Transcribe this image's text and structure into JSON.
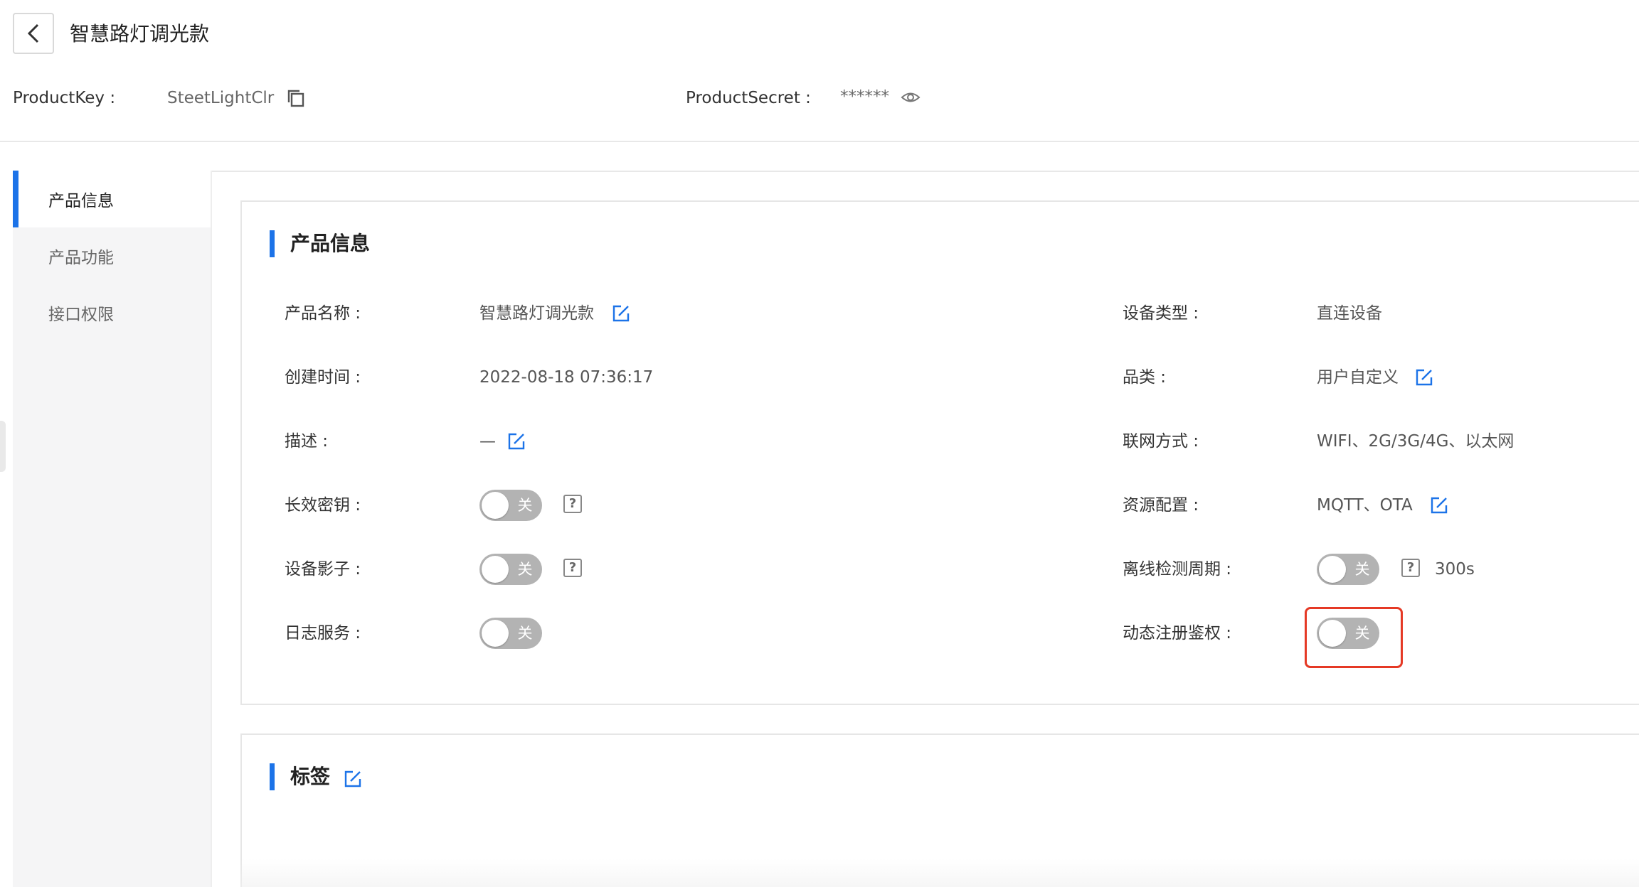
{
  "header": {
    "title": "智慧路灯调光款",
    "product_key_label": "ProductKey :",
    "product_key_value": "SteetLightClr",
    "product_secret_label": "ProductSecret :",
    "product_secret_value": "******"
  },
  "sidebar": {
    "items": [
      {
        "label": "产品信息",
        "active": true
      },
      {
        "label": "产品功能",
        "active": false
      },
      {
        "label": "接口权限",
        "active": false
      }
    ]
  },
  "product_info": {
    "section_title": "产品信息",
    "left_fields": [
      {
        "label": "产品名称 :",
        "value": "智慧路灯调光款"
      },
      {
        "label": "创建时间 :",
        "value": "2022-08-18 07:36:17"
      },
      {
        "label": "描述 :",
        "value": "—"
      },
      {
        "label": "长效密钥 :",
        "toggle_text": "关"
      },
      {
        "label": "设备影子 :",
        "toggle_text": "关"
      },
      {
        "label": "日志服务 :",
        "toggle_text": "关"
      }
    ],
    "right_fields": [
      {
        "label": "设备类型 :",
        "value": "直连设备"
      },
      {
        "label": "品类 :",
        "value": "用户自定义"
      },
      {
        "label": "联网方式 :",
        "value": "WIFI、2G/3G/4G、以太网"
      },
      {
        "label": "资源配置 :",
        "value": "MQTT、OTA"
      },
      {
        "label": "离线检测周期 :",
        "toggle_text": "关",
        "extra": "300s"
      },
      {
        "label": "动态注册鉴权 :",
        "toggle_text": "关"
      }
    ],
    "help_mark": "?"
  },
  "tags": {
    "section_title": "标签"
  },
  "colors": {
    "accent": "#1c73e8",
    "toggle_off": "#b3b3b3",
    "highlight": "#e53925"
  }
}
